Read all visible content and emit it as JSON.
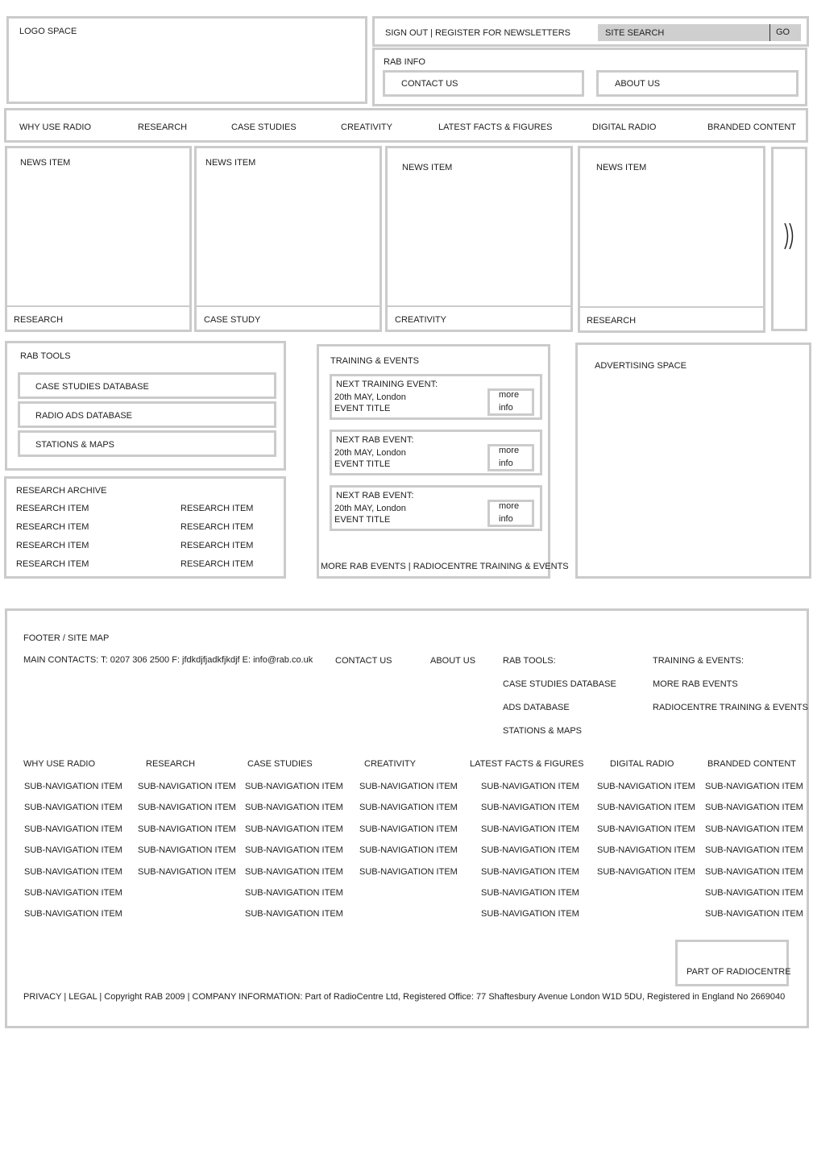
{
  "logo": {
    "label": "LOGO SPACE"
  },
  "topbar": {
    "account_links": "SIGN OUT | REGISTER FOR NEWSLETTERS",
    "search_placeholder": "SITE SEARCH",
    "go_label": "GO"
  },
  "rab_info": {
    "title": "RAB INFO",
    "contact_us": "CONTACT US",
    "about_us": "ABOUT US"
  },
  "nav": {
    "items": [
      "WHY USE RADIO",
      "RESEARCH",
      "CASE STUDIES",
      "CREATIVITY",
      "LATEST FACTS & FIGURES",
      "DIGITAL RADIO",
      "BRANDED CONTENT"
    ]
  },
  "news": {
    "items": [
      {
        "title": "NEWS ITEM",
        "category": "RESEARCH"
      },
      {
        "title": "NEWS ITEM",
        "category": "CASE STUDY"
      },
      {
        "title": "NEWS ITEM",
        "category": "CREATIVITY"
      },
      {
        "title": "NEWS ITEM",
        "category": "RESEARCH"
      }
    ],
    "next_icon": "double-chevron-right",
    "next_glyph": "⟫"
  },
  "rab_tools": {
    "title": "RAB TOOLS",
    "items": [
      "CASE STUDIES DATABASE",
      "RADIO ADS DATABASE",
      "STATIONS & MAPS"
    ]
  },
  "research_archive": {
    "title": "RESEARCH ARCHIVE",
    "items": [
      "RESEARCH ITEM",
      "RESEARCH ITEM",
      "RESEARCH ITEM",
      "RESEARCH ITEM",
      "RESEARCH ITEM",
      "RESEARCH ITEM",
      "RESEARCH ITEM",
      "RESEARCH ITEM"
    ]
  },
  "training": {
    "title": "TRAINING & EVENTS",
    "events": [
      {
        "heading": "NEXT TRAINING EVENT:",
        "date": "20th MAY, London",
        "title": "EVENT TITLE",
        "more": "more",
        "info": "info"
      },
      {
        "heading": "NEXT RAB EVENT:",
        "date": "20th MAY, London",
        "title": "EVENT TITLE",
        "more": "more",
        "info": "info"
      },
      {
        "heading": "NEXT RAB EVENT:",
        "date": "20th MAY, London",
        "title": "EVENT TITLE",
        "more": "more",
        "info": "info"
      }
    ],
    "footer_links": "MORE RAB EVENTS | RADIOCENTRE TRAINING & EVENTS"
  },
  "advertising": {
    "label": "ADVERTISING SPACE"
  },
  "footer": {
    "title": "FOOTER / SITE MAP",
    "main_contacts": "MAIN CONTACTS:  T: 0207 306 2500   F: jfdkdjfjadkfjkdjf    E: info@rab.co.uk",
    "contact_us": "CONTACT US",
    "about_us": "ABOUT US",
    "rab_tools": {
      "title": "RAB TOOLS:",
      "items": [
        "CASE STUDIES DATABASE",
        "ADS DATABASE",
        "STATIONS & MAPS"
      ]
    },
    "training": {
      "title": "TRAINING & EVENTS:",
      "items": [
        "MORE RAB EVENTS",
        "RADIOCENTRE TRAINING & EVENTS"
      ]
    },
    "sitemap": [
      {
        "heading": "WHY USE RADIO",
        "items": [
          "SUB-NAVIGATION ITEM",
          "SUB-NAVIGATION ITEM",
          "SUB-NAVIGATION ITEM",
          "SUB-NAVIGATION ITEM",
          "SUB-NAVIGATION ITEM",
          "SUB-NAVIGATION ITEM",
          "SUB-NAVIGATION ITEM"
        ]
      },
      {
        "heading": "RESEARCH",
        "items": [
          "SUB-NAVIGATION ITEM",
          "SUB-NAVIGATION ITEM",
          "SUB-NAVIGATION ITEM",
          "SUB-NAVIGATION ITEM",
          "SUB-NAVIGATION ITEM"
        ]
      },
      {
        "heading": "CASE STUDIES",
        "items": [
          "SUB-NAVIGATION ITEM",
          "SUB-NAVIGATION ITEM",
          "SUB-NAVIGATION ITEM",
          "SUB-NAVIGATION ITEM",
          "SUB-NAVIGATION ITEM",
          "SUB-NAVIGATION ITEM",
          "SUB-NAVIGATION ITEM"
        ]
      },
      {
        "heading": "CREATIVITY",
        "items": [
          "SUB-NAVIGATION ITEM",
          "SUB-NAVIGATION ITEM",
          "SUB-NAVIGATION ITEM",
          "SUB-NAVIGATION ITEM",
          "SUB-NAVIGATION ITEM"
        ]
      },
      {
        "heading": "LATEST FACTS & FIGURES",
        "items": [
          "SUB-NAVIGATION ITEM",
          "SUB-NAVIGATION ITEM",
          "SUB-NAVIGATION ITEM",
          "SUB-NAVIGATION ITEM",
          "SUB-NAVIGATION ITEM",
          "SUB-NAVIGATION ITEM",
          "SUB-NAVIGATION ITEM"
        ]
      },
      {
        "heading": "DIGITAL RADIO",
        "items": [
          "SUB-NAVIGATION ITEM",
          "SUB-NAVIGATION ITEM",
          "SUB-NAVIGATION ITEM",
          "SUB-NAVIGATION ITEM",
          "SUB-NAVIGATION ITEM"
        ]
      },
      {
        "heading": "BRANDED CONTENT",
        "items": [
          "SUB-NAVIGATION ITEM",
          "SUB-NAVIGATION ITEM",
          "SUB-NAVIGATION ITEM",
          "SUB-NAVIGATION ITEM",
          "SUB-NAVIGATION ITEM",
          "SUB-NAVIGATION ITEM",
          "SUB-NAVIGATION ITEM"
        ]
      }
    ],
    "part_of": "PART OF RADIOCENTRE",
    "legal": "PRIVACY  | LEGAL | Copyright RAB 2009 |  COMPANY INFORMATION: Part of RadioCentre Ltd, Registered Office: 77 Shaftesbury Avenue London W1D 5DU, Registered in England No 2669040"
  },
  "colors": {
    "border": "#cbcbcb",
    "search_bg": "#cfcfcf",
    "text": "#1e1e1e"
  }
}
